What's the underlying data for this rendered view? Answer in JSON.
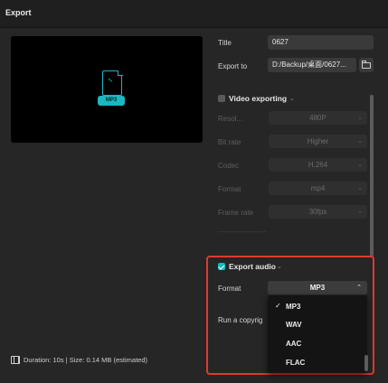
{
  "window": {
    "title": "Export"
  },
  "preview": {
    "file_badge": "MP3",
    "file_icon": "audio-file-icon"
  },
  "form": {
    "title_label": "Title",
    "title_value": "0627",
    "export_to_label": "Export to",
    "export_to_value": "D:/Backup/桌面/0627..."
  },
  "video": {
    "section_label": "Video exporting",
    "enabled": false,
    "rows": [
      {
        "label": "Resol...",
        "value": "480P"
      },
      {
        "label": "Bit rate",
        "value": "Higher"
      },
      {
        "label": "Codec",
        "value": "H.264"
      },
      {
        "label": "Format",
        "value": "mp4"
      },
      {
        "label": "Frame rate",
        "value": "30fps"
      }
    ],
    "extra": "--------------------"
  },
  "audio": {
    "section_label": "Export audio",
    "enabled": true,
    "format_label": "Format",
    "format_value": "MP3",
    "copyright_label": "Run a copyrig",
    "options": [
      {
        "label": "MP3",
        "selected": true
      },
      {
        "label": "WAV",
        "selected": false
      },
      {
        "label": "AAC",
        "selected": false
      },
      {
        "label": "FLAC",
        "selected": false
      }
    ]
  },
  "footer": {
    "info": "Duration: 10s | Size: 0.14 MB (estimated)"
  },
  "colors": {
    "accent": "#19b8c2",
    "highlight": "#e0392f",
    "background": "#262626"
  }
}
